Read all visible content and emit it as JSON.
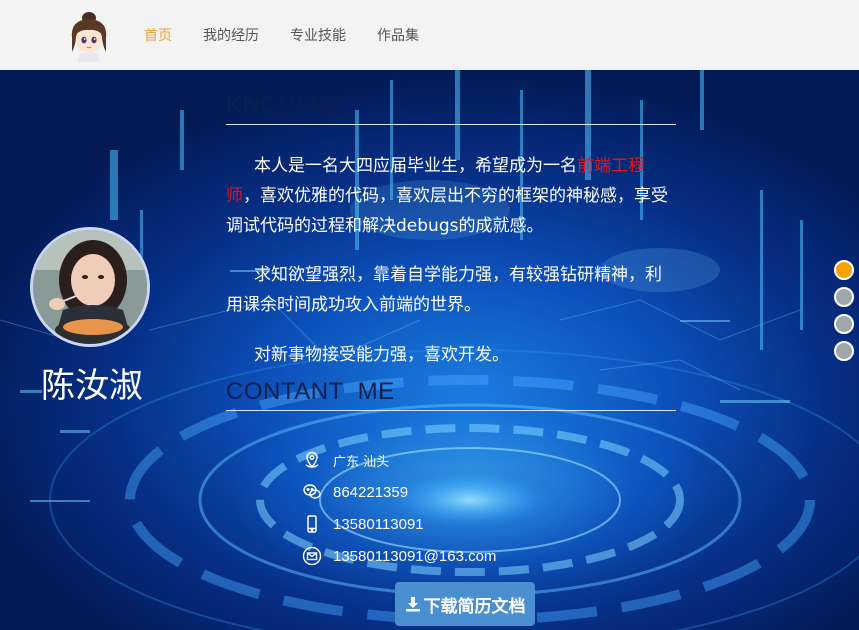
{
  "nav": {
    "items": [
      "首页",
      "我的经历",
      "专业技能",
      "作品集"
    ],
    "active_index": 0
  },
  "profile": {
    "name": "陈汝淑"
  },
  "about": {
    "title": "KNOW ME",
    "p1_before": "本人是一名大四应届毕业生，希望成为一名",
    "p1_highlight": "前端工程师",
    "p1_after": "，喜欢优雅的代码，喜欢层出不穷的框架的神秘感，享受调试代码的过程和解决debugs的成就感。",
    "p2": "求知欲望强烈，靠着自学能力强，有较强钻研精神，利用课余时间成功攻入前端的世界。",
    "p3": "对新事物接受能力强，喜欢开发。"
  },
  "contact": {
    "title": "CONTANT  ME",
    "location": "广东 汕头",
    "wechat": "864221359",
    "phone": "13580113091",
    "email": "13580113091@163.com"
  },
  "download_label": "下载简历文档",
  "page_dots": {
    "count": 4,
    "active_index": 0
  },
  "colors": {
    "nav_active": "#f0a23c",
    "highlight": "#e8141c",
    "button": "#4a8fd0",
    "dot_active": "#f6a300"
  }
}
